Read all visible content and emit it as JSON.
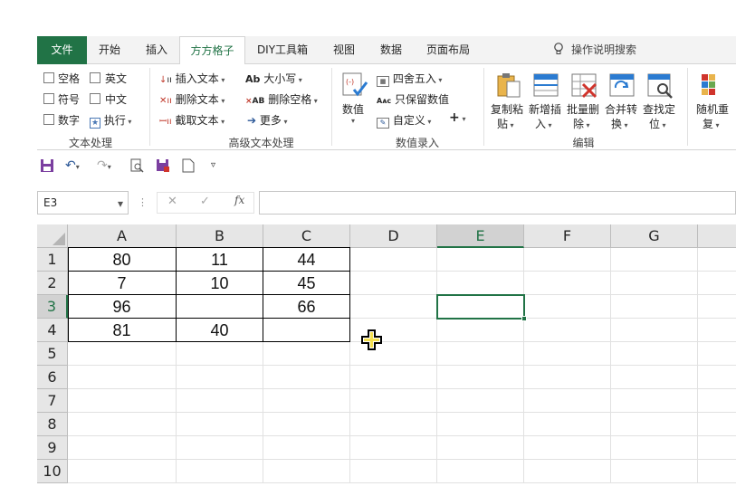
{
  "tabs": [
    {
      "label": "文件"
    },
    {
      "label": "开始"
    },
    {
      "label": "插入"
    },
    {
      "label": "方方格子"
    },
    {
      "label": "DIY工具箱"
    },
    {
      "label": "视图"
    },
    {
      "label": "数据"
    },
    {
      "label": "页面布局"
    }
  ],
  "tell_me": "操作说明搜索",
  "ribbon": {
    "text_group": {
      "label": "文本处理",
      "checks": [
        "空格",
        "英文",
        "符号",
        "中文",
        "数字"
      ],
      "execute": "执行"
    },
    "adv_text_group": {
      "label": "高级文本处理",
      "items": [
        "插入文本",
        "删除文本",
        "截取文本",
        "大小写",
        "删除空格",
        "更多"
      ]
    },
    "number_group": {
      "label": "数值录入",
      "big_button": "数值",
      "items": [
        "四舍五入",
        "只保留数值",
        "自定义"
      ]
    },
    "edit_group": {
      "label": "编辑",
      "buttons": [
        {
          "line1": "复制粘",
          "line2": "贴"
        },
        {
          "line1": "新增插",
          "line2": "入"
        },
        {
          "line1": "批量删",
          "line2": "除"
        },
        {
          "line1": "合并转",
          "line2": "换"
        },
        {
          "line1": "查找定",
          "line2": "位"
        },
        {
          "line1": "随机重",
          "line2": "复"
        }
      ]
    }
  },
  "name_box": "E3",
  "formula_symbols": {
    "cancel": "✕",
    "confirm": "✓",
    "fx": "fx"
  },
  "columns": [
    "A",
    "B",
    "C",
    "D",
    "E",
    "F",
    "G"
  ],
  "rows": [
    "1",
    "2",
    "3",
    "4",
    "5",
    "6",
    "7",
    "8",
    "9",
    "10"
  ],
  "cells": [
    [
      "80",
      "11",
      "44"
    ],
    [
      "7",
      "10",
      "45"
    ],
    [
      "96",
      "",
      "66"
    ],
    [
      "81",
      "40",
      ""
    ]
  ],
  "selected_cell": "E3",
  "colors": {
    "accent": "#217346"
  }
}
